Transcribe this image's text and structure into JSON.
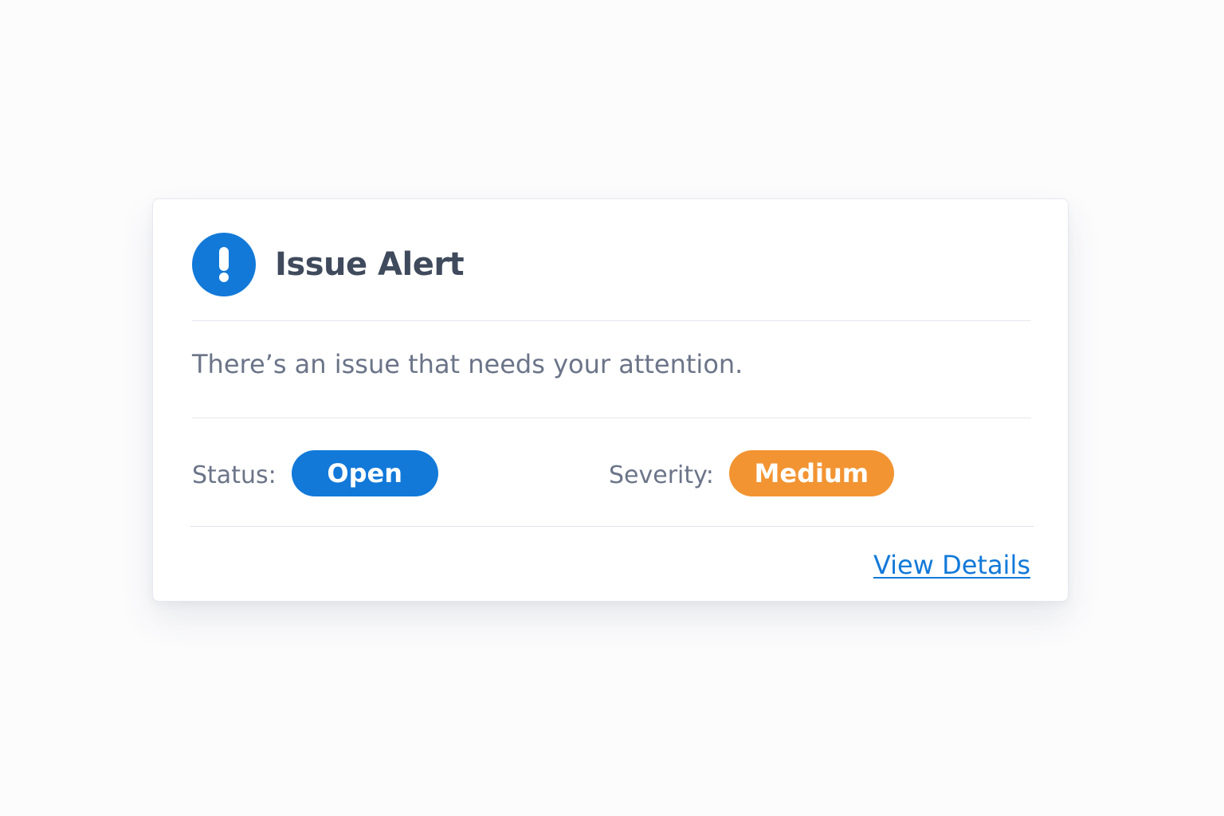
{
  "alert": {
    "title": "Issue Alert",
    "icon": "exclamation-circle-icon",
    "message": "There’s an issue that needs your attention.",
    "status": {
      "label": "Status:",
      "value": "Open",
      "color": "#1279d9"
    },
    "severity": {
      "label": "Severity:",
      "value": "Medium",
      "color": "#f29432"
    },
    "link": {
      "label": "View Details",
      "color": "#1279d9"
    }
  }
}
